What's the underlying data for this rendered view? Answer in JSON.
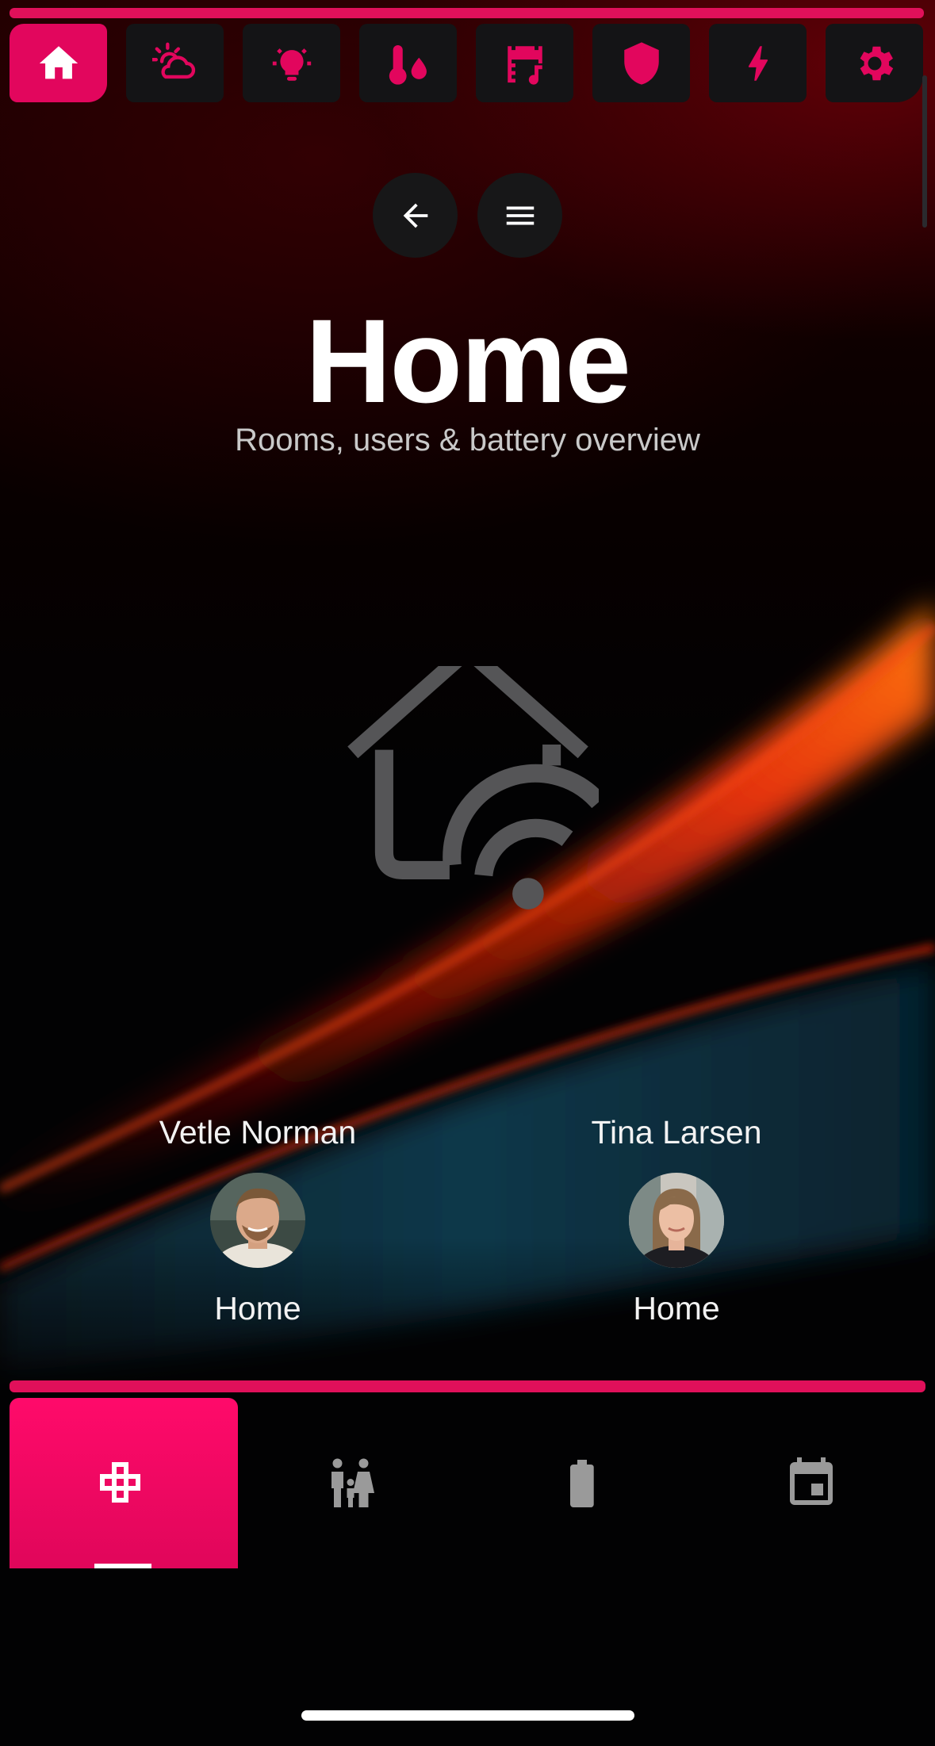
{
  "app": {
    "title": "Home",
    "subtitle": "Rooms, users & battery overview"
  },
  "top_nav": {
    "items": [
      {
        "icon": "home-icon",
        "active": true
      },
      {
        "icon": "weather-icon",
        "active": false
      },
      {
        "icon": "lightbulb-icon",
        "active": false
      },
      {
        "icon": "climate-icon",
        "active": false
      },
      {
        "icon": "media-icon",
        "active": false
      },
      {
        "icon": "shield-icon",
        "active": false
      },
      {
        "icon": "energy-icon",
        "active": false
      },
      {
        "icon": "settings-icon",
        "active": false
      }
    ]
  },
  "controls": {
    "back_icon": "arrow-left-icon",
    "menu_icon": "menu-icon"
  },
  "hero_icon": "home-wifi-icon",
  "users": [
    {
      "name": "Vetle Norman",
      "state": "Home"
    },
    {
      "name": "Tina Larsen",
      "state": "Home"
    }
  ],
  "bottom_tabs": [
    {
      "icon": "rooms-icon",
      "active": true
    },
    {
      "icon": "family-icon",
      "active": false
    },
    {
      "icon": "battery-icon",
      "active": false
    },
    {
      "icon": "calendar-icon",
      "active": false
    }
  ],
  "colors": {
    "accent": "#e2065d",
    "nav_background": "#141416",
    "background": "#020203"
  }
}
